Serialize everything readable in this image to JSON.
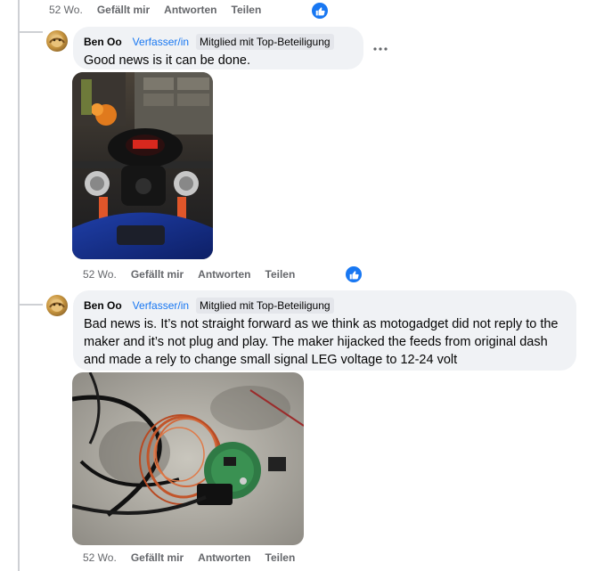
{
  "top_meta": {
    "time": "52 Wo.",
    "like": "Gefällt mir",
    "reply": "Antworten",
    "share": "Teilen"
  },
  "comments": [
    {
      "author": "Ben Oo",
      "role": "Verfasser/in",
      "badge": "Mitglied mit Top-Beteiligung",
      "text": "Good news is it can be done.",
      "meta": {
        "time": "52 Wo.",
        "like": "Gefällt mir",
        "reply": "Antworten",
        "share": "Teilen"
      }
    },
    {
      "author": "Ben Oo",
      "role": "Verfasser/in",
      "badge": "Mitglied mit Top-Beteiligung",
      "text": "Bad news is. It’s not straight forward as we think as motogadget did not reply to the maker and it’s not plug and play. The maker hijacked the feeds from original dash and made a rely to change small signal LEG voltage to 12-24 volt",
      "meta": {
        "time": "52 Wo.",
        "like": "Gefällt mir",
        "reply": "Antworten",
        "share": "Teilen"
      }
    }
  ],
  "more_icon": "more-horizontal-icon",
  "like_icon": "thumbs-up-icon",
  "colors": {
    "accent": "#1877f2",
    "bubble": "#f0f2f5",
    "meta": "#65676b"
  }
}
